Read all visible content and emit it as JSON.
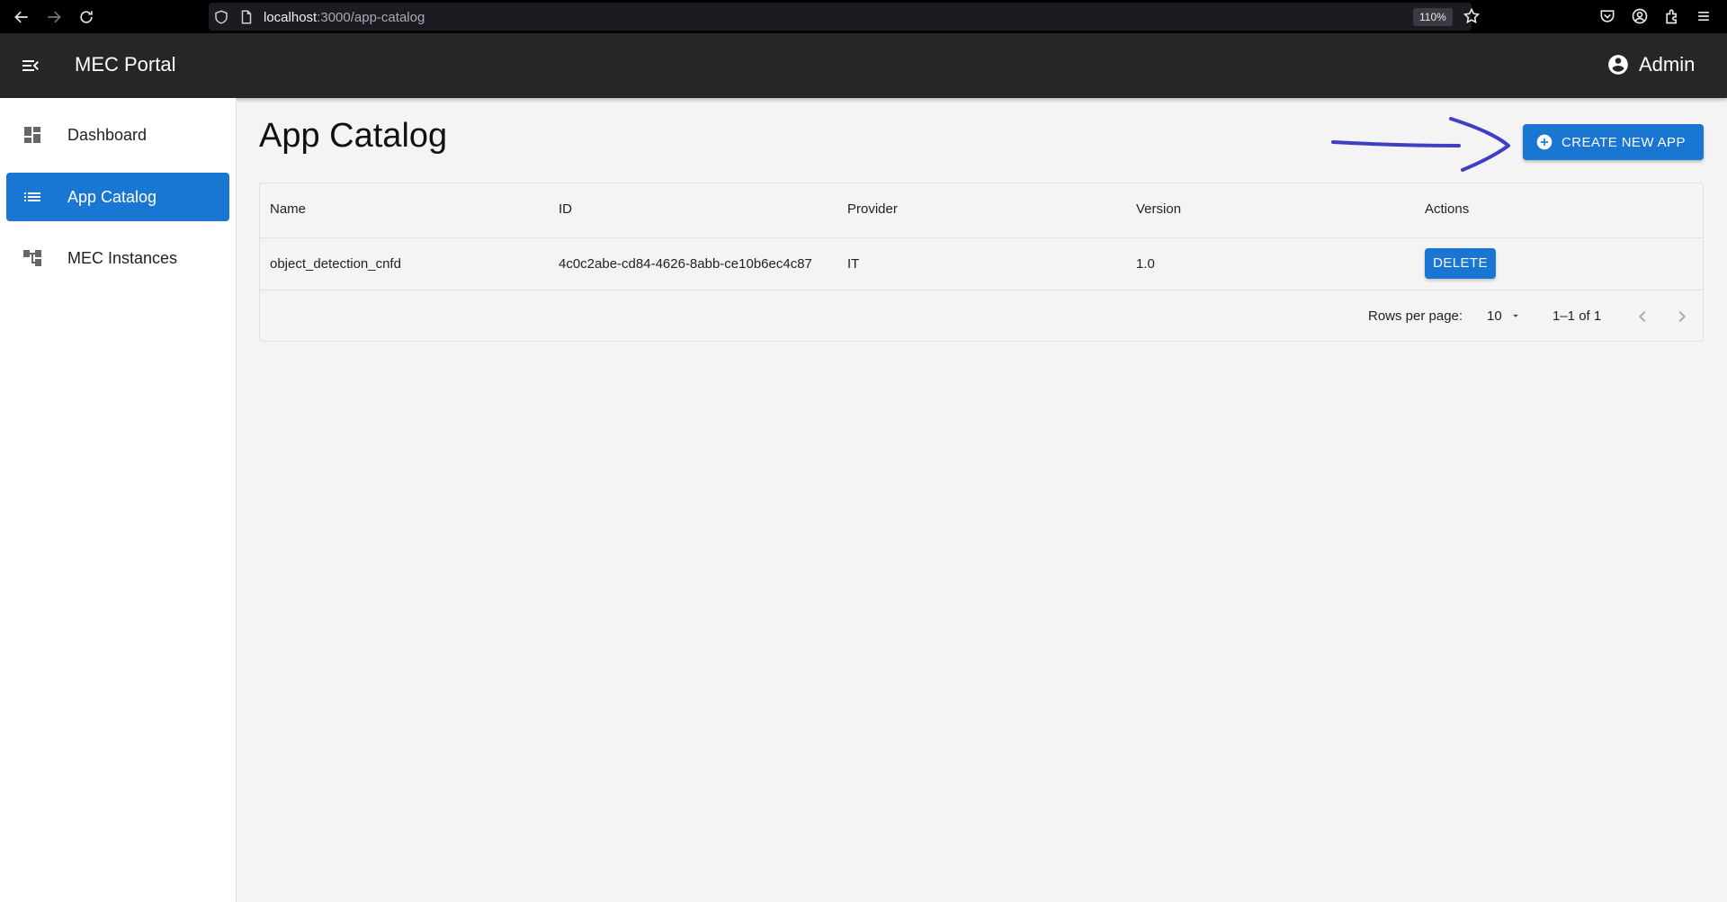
{
  "browser": {
    "url_host": "localhost",
    "url_path": ":3000/app-catalog",
    "zoom": "110%"
  },
  "app_bar": {
    "title": "MEC Portal",
    "user_label": "Admin"
  },
  "sidebar": {
    "items": [
      {
        "label": "Dashboard",
        "icon": "dashboard-icon"
      },
      {
        "label": "App Catalog",
        "icon": "list-icon",
        "active": true
      },
      {
        "label": "MEC Instances",
        "icon": "hub-icon"
      }
    ]
  },
  "main": {
    "title": "App Catalog",
    "create_button_label": "CREATE NEW APP",
    "table": {
      "columns": [
        "Name",
        "ID",
        "Provider",
        "Version",
        "Actions"
      ],
      "rows": [
        {
          "name": "object_detection_cnfd",
          "id": "4c0c2abe-cd84-4626-8abb-ce10b6ec4c87",
          "provider": "IT",
          "version": "1.0",
          "action_label": "DELETE"
        }
      ]
    },
    "pagination": {
      "rows_per_page_label": "Rows per page:",
      "rows_per_page_value": "10",
      "range_label": "1–1 of 1"
    }
  },
  "colors": {
    "primary": "#1976d2",
    "app_bar": "#262626",
    "annotation": "#3f3fc4"
  }
}
